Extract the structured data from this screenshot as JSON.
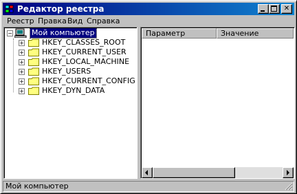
{
  "window": {
    "title": "Редактор реестра",
    "icon": "regedit-icon"
  },
  "menu": [
    {
      "label": "Реестр"
    },
    {
      "label": "Правка"
    },
    {
      "label": "Вид"
    },
    {
      "label": "Справка"
    }
  ],
  "tree": {
    "root": "Мой компьютер",
    "keys": [
      {
        "label": "HKEY_CLASSES_ROOT"
      },
      {
        "label": "HKEY_CURRENT_USER"
      },
      {
        "label": "HKEY_LOCAL_MACHINE"
      },
      {
        "label": "HKEY_USERS"
      },
      {
        "label": "HKEY_CURRENT_CONFIG"
      },
      {
        "label": "HKEY_DYN_DATA"
      }
    ]
  },
  "list": {
    "columns": [
      "Параметр",
      "Значение"
    ]
  },
  "status": {
    "text": "Мой компьютер"
  },
  "colors": {
    "title_start": "#000080",
    "title_end": "#1084d0",
    "selection": "#000080",
    "folder": "#ffff80"
  }
}
